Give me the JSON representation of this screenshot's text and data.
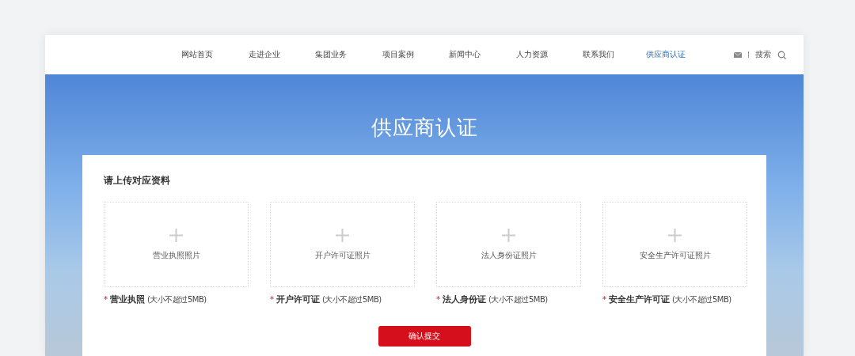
{
  "nav": {
    "items": [
      {
        "label": "网站首页",
        "selected": false
      },
      {
        "label": "走进企业",
        "selected": false
      },
      {
        "label": "集团业务",
        "selected": false
      },
      {
        "label": "项目案例",
        "selected": false
      },
      {
        "label": "新闻中心",
        "selected": false
      },
      {
        "label": "人力资源",
        "selected": false
      },
      {
        "label": "联系我们",
        "selected": false
      },
      {
        "label": "供应商认证",
        "selected": true
      }
    ],
    "search_label": "搜索"
  },
  "banner": {
    "title": "供应商认证"
  },
  "form": {
    "heading": "请上传对应资料",
    "uploads": [
      {
        "placeholder": "营业执照照片",
        "required_mark": "*",
        "label": "营业执照",
        "hint": "(大小不超过5MB)"
      },
      {
        "placeholder": "开户许可证照片",
        "required_mark": "*",
        "label": "开户许可证",
        "hint": "(大小不超过5MB)"
      },
      {
        "placeholder": "法人身份证照片",
        "required_mark": "*",
        "label": "法人身份证",
        "hint": "(大小不超过5MB)"
      },
      {
        "placeholder": "安全生产许可证照片",
        "required_mark": "*",
        "label": "安全生产许可证",
        "hint": "(大小不超过5MB)"
      }
    ],
    "submit": "确认提交"
  }
}
